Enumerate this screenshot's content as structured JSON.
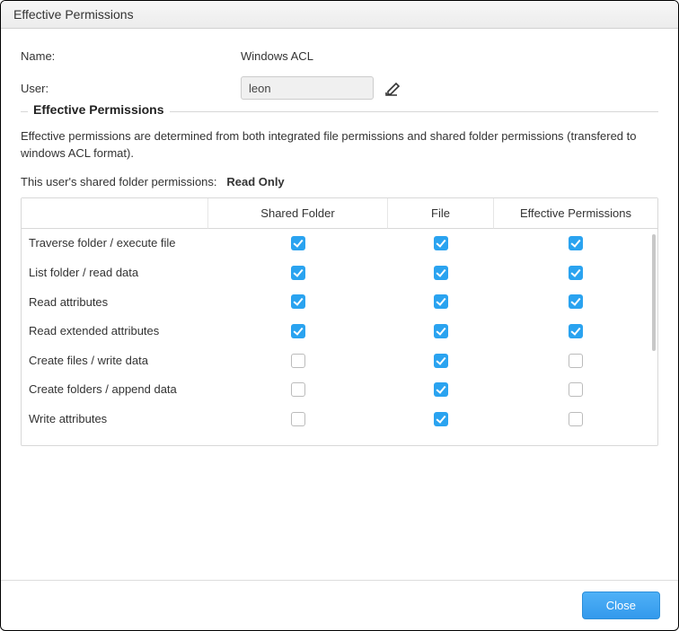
{
  "window": {
    "title": "Effective Permissions"
  },
  "form": {
    "name_label": "Name:",
    "name_value": "Windows ACL",
    "user_label": "User:",
    "user_value": "leon"
  },
  "fieldset": {
    "title": "Effective Permissions",
    "description": "Effective permissions are determined from both integrated file permissions and shared folder permissions (transfered to windows ACL format).",
    "shared_prefix": "This user's shared folder permissions:",
    "shared_value": "Read Only"
  },
  "table": {
    "headers": [
      "",
      "Shared Folder",
      "File",
      "Effective Permissions"
    ],
    "rows": [
      {
        "label": "Traverse folder / execute file",
        "shared": true,
        "file": true,
        "effective": true
      },
      {
        "label": "List folder / read data",
        "shared": true,
        "file": true,
        "effective": true
      },
      {
        "label": "Read attributes",
        "shared": true,
        "file": true,
        "effective": true
      },
      {
        "label": "Read extended attributes",
        "shared": true,
        "file": true,
        "effective": true
      },
      {
        "label": "Create files / write data",
        "shared": false,
        "file": true,
        "effective": false
      },
      {
        "label": "Create folders / append data",
        "shared": false,
        "file": true,
        "effective": false
      },
      {
        "label": "Write attributes",
        "shared": false,
        "file": true,
        "effective": false
      }
    ]
  },
  "footer": {
    "close_label": "Close"
  }
}
